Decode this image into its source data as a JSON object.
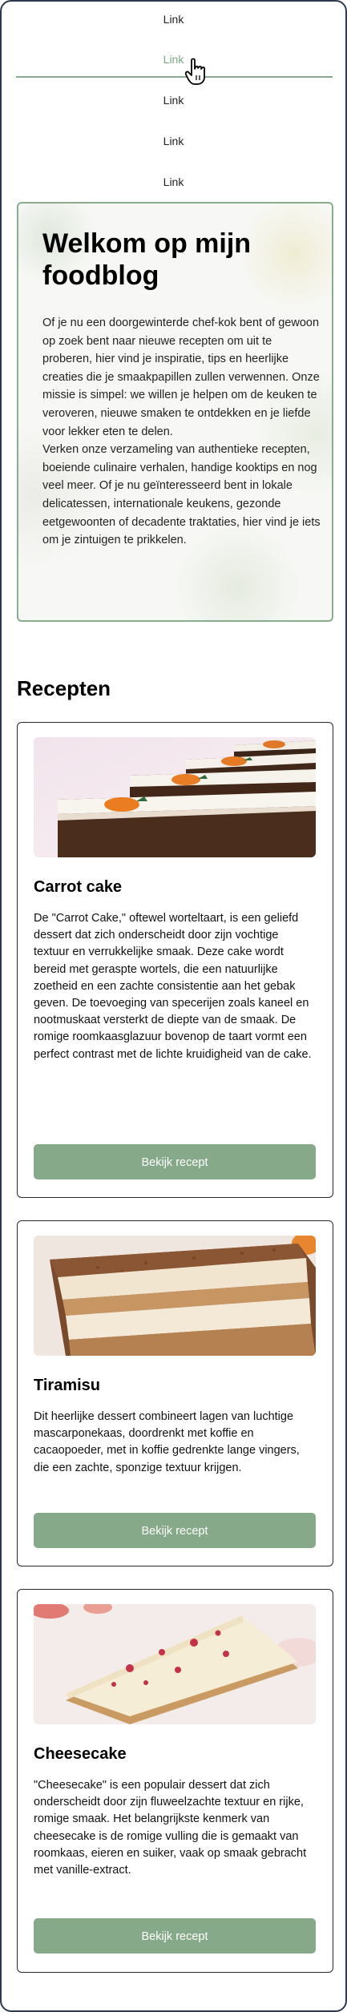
{
  "nav": {
    "links": [
      "Link",
      "Link",
      "Link",
      "Link",
      "Link"
    ],
    "active_index": 1
  },
  "hero": {
    "title": "Welkom op mijn foodblog",
    "text": "Of je nu een doorgewinterde chef-kok bent of gewoon op zoek bent naar nieuwe recepten om uit te proberen, hier vind je inspiratie, tips en heerlijke creaties die je smaakpapillen zullen verwennen. Onze missie is simpel: we willen je helpen om de keuken te veroveren, nieuwe smaken te ontdekken en je liefde voor lekker eten te delen.\nVerken onze verzameling van authentieke recepten, boeiende culinaire verhalen, handige kooktips en nog veel meer. Of je nu geïnteresseerd bent in lokale delicatessen, internationale keukens, gezonde eetgewoonten of decadente traktaties, hier vind je iets om je zintuigen te prikkelen."
  },
  "recipes_section": {
    "title": "Recepten",
    "cards": [
      {
        "image": "carrot-cake-photo",
        "title": "Carrot cake",
        "text": "De \"Carrot Cake,\" oftewel worteltaart, is een geliefd dessert dat zich onderscheidt door zijn vochtige textuur en verrukkelijke smaak. Deze cake wordt bereid met geraspte wortels, die een natuurlijke zoetheid en een zachte consistentie aan het gebak geven. De toevoeging van specerijen zoals kaneel en nootmuskaat versterkt de diepte van de smaak. De romige roomkaasglazuur bovenop de taart vormt een perfect contrast met de lichte kruidigheid van de cake.",
        "button": "Bekijk recept"
      },
      {
        "image": "tiramisu-photo",
        "title": "Tiramisu",
        "text": "Dit heerlijke dessert combineert lagen van luchtige mascarponekaas, doordrenkt met koffie en cacaopoeder, met in koffie gedrenkte lange vingers, die een zachte, sponzige textuur krijgen.",
        "button": "Bekijk recept"
      },
      {
        "image": "cheesecake-photo",
        "title": "Cheesecake",
        "text": "\"Cheesecake\" is een populair dessert dat zich onderscheidt door zijn fluweelzachte textuur en rijke, romige smaak. Het belangrijkste kenmerk van cheesecake is de romige vulling die is gemaakt van roomkaas, eieren en suiker, vaak op smaak gebracht met vanille-extract.",
        "button": "Bekijk recept"
      }
    ]
  },
  "colors": {
    "accent": "#85a989",
    "frame": "#2b3a4f",
    "active_link": "#7aa883"
  }
}
